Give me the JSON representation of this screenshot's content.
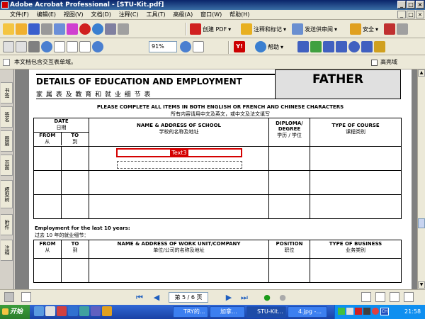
{
  "window": {
    "title": "Adobe Acrobat Professional - [STU-Kit.pdf]",
    "min": "_",
    "max": "□",
    "close": "×"
  },
  "menu": [
    "文件(F)",
    "编辑(E)",
    "视图(V)",
    "文档(D)",
    "注释(C)",
    "工具(T)",
    "高级(A)",
    "窗口(W)",
    "帮助(H)"
  ],
  "toolbar1": {
    "create_pdf": "创建 PDF",
    "comment_markup": "注释和标记",
    "send_review": "发送供审阅",
    "security": "安全"
  },
  "toolbar2": {
    "zoom": "91%",
    "help": "帮助"
  },
  "infobar": {
    "message": "本文档包含交互表单域。",
    "highlight_label": "高亮域"
  },
  "sidebar_tabs": [
    "书签",
    "签名",
    "图层",
    "页面",
    "模型树",
    "附件",
    "注释"
  ],
  "form": {
    "title": "DETAILS OF EDUCATION AND EMPLOYMENT",
    "title_cn": "家 属 表 及 教 育 和 就 业 细 节 表",
    "header_right": "FATHER",
    "instruction": "PLEASE COMPLETE ALL ITEMS IN BOTH ENGLISH OR FRENCH AND CHINESE CHARACTERS",
    "instruction_cn": "所有内容请用中文及英文，或中文及法文填写",
    "edu_headers": {
      "date": "DATE",
      "date_cn": "日期",
      "from": "FROM",
      "from_cn": "从",
      "to": "TO",
      "to_cn": "到",
      "school": "NAME & ADDRESS OF SCHOOL",
      "school_cn": "学校的名称及地址",
      "diploma": "DIPLOMA/ DEGREE",
      "diploma_cn": "学历 / 学位",
      "course": "TYPE OF COURSE",
      "course_cn": "课程类别"
    },
    "field_name": "Text3",
    "employment_title": "Employment for the last 10 years:",
    "employment_title_cn": "过去 10 年的就业细节：",
    "emp_headers": {
      "from": "FROM",
      "from_cn": "从",
      "to": "TO",
      "to_cn": "到",
      "company": "NAME & ADDRESS OF WORK UNIT/COMPANY",
      "company_cn": "单位/公司的名称及地址",
      "position": "POSITION",
      "position_cn": "职位",
      "business": "TYPE OF BUSINESS",
      "business_cn": "业务类别"
    }
  },
  "navigation": {
    "page_indicator": "第 5 / 6 页"
  },
  "taskbar": {
    "start": "开始",
    "items": [
      "TRY的...",
      "加拿...",
      "STU-Kit...",
      "4.jpg -..."
    ],
    "clock": "21:58",
    "ime": "CH"
  },
  "colors": {
    "field_border": "#d40000",
    "title_bar": "#0a246a",
    "taskbar": "#2458c8"
  }
}
